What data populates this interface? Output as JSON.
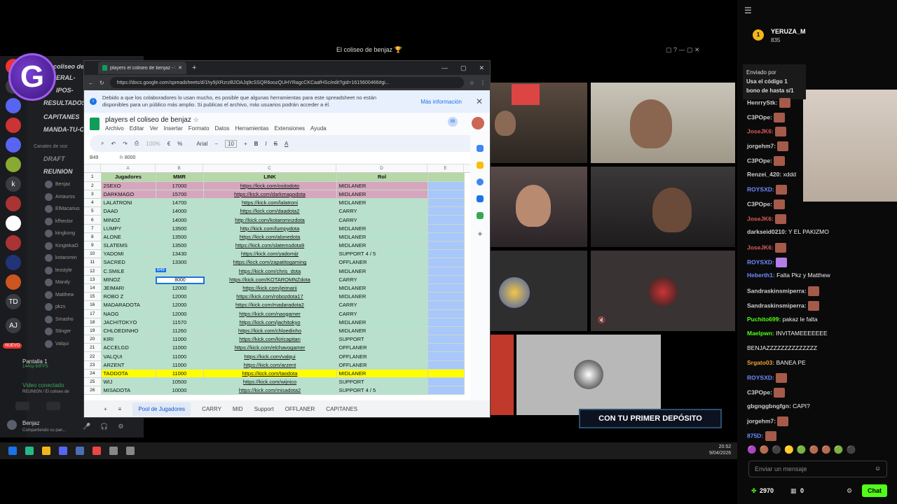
{
  "stream": {
    "title": "El coliseo de benjaz 🏆"
  },
  "discord": {
    "server_partial": "coliseo de",
    "channels": [
      "ERAL-",
      "IPOS-",
      "RESULTADOS",
      "CAPITANES",
      "MANDA-TU-C",
      "DRAFT"
    ],
    "voice_section": "Canales de voz",
    "voice_channel": "REUNION",
    "voice_users": [
      "Benjaz",
      "Antauros",
      "ElMacarius",
      "kfhector",
      "kingkong",
      "KingtekaO",
      "kotaromin",
      "leostyle",
      "Mandy",
      "Matthew",
      "pkzs",
      "Smasho",
      "Stinger",
      "Valqui"
    ],
    "screen_label": "Pantalla 1",
    "screen_sub": "1440p 60FPS",
    "video_status": "Video conectado",
    "video_channel": "REUNION / El coliseo de",
    "user_name": "Benjaz",
    "user_status": "Compartiendo su pan...",
    "nuevo": "NUEVO"
  },
  "chrome": {
    "tab_title": "players el coliseo de benjaz - Hoja",
    "url": "https://docs.google.com/spreadsheets/d/1hy9jXRzrzB2OAJq9cSSQR6oozQUHYRagcCKCaafHSc/edit?gid=1615600466#gi...",
    "notice": "Debido a que los colaboradores lo usan mucho, es posible que algunas herramientas para este spreadsheet no están disponibles para un público más amplio. Si publicas el archivo, más usuarios podrán acceder a él.",
    "notice_more": "Más información",
    "doc_title": "players el coliseo de benjaz",
    "menus": [
      "Archivo",
      "Editar",
      "Ver",
      "Insertar",
      "Formato",
      "Datos",
      "Herramientas",
      "Extensiones",
      "Ayuda"
    ],
    "font": "Arial",
    "font_size": "10",
    "zoom": "100%",
    "cell_ref": "B49",
    "formula_value": "8000",
    "cols": [
      "A",
      "B",
      "C",
      "D",
      "E"
    ],
    "headers": [
      "Jugadores",
      "MMR",
      "LINK",
      "Rol"
    ],
    "rows": [
      {
        "n": "2",
        "name": "2SEXO",
        "mmr": "17000",
        "link": "https://kick.com/ositodoto",
        "rol": "MIDLANER",
        "c": "p"
      },
      {
        "n": "3",
        "name": "DARKMAGO",
        "mmr": "15700",
        "link": "https://kick.com/darkmagodota",
        "rol": "MIDLANER",
        "c": "p"
      },
      {
        "n": "4",
        "name": "LALATRONI",
        "mmr": "14700",
        "link": "https://kick.com/lalatroni",
        "rol": "MIDLANER",
        "c": "g"
      },
      {
        "n": "5",
        "name": "DAAD",
        "mmr": "14000",
        "link": "https://kick.com/daadota2",
        "rol": "CARRY",
        "c": "g"
      },
      {
        "n": "6",
        "name": "MINOZ",
        "mmr": "14000",
        "link": "http://kick.com/kotaromnzdota",
        "rol": "CARRY",
        "c": "g"
      },
      {
        "n": "7",
        "name": "LUMPY",
        "mmr": "13500",
        "link": "http://kick.com/lumpydota",
        "rol": "MIDLANER",
        "c": "g"
      },
      {
        "n": "8",
        "name": "ALONE",
        "mmr": "13500",
        "link": "https://kick.com/alonedota",
        "rol": "MIDLANER",
        "c": "g"
      },
      {
        "n": "9",
        "name": "SLATEMS",
        "mmr": "13500",
        "link": "https://kick.com/slatemsdota9",
        "rol": "MIDLANER",
        "c": "g"
      },
      {
        "n": "10",
        "name": "YADOMI",
        "mmr": "13430",
        "link": "https://kick.com/yadomijr",
        "rol": "SUPPORT 4 / 5",
        "c": "g"
      },
      {
        "n": "11",
        "name": "SACRED",
        "mmr": "13300",
        "link": "https://kick.com/zapatitogaming",
        "rol": "OFFLANER",
        "c": "g"
      },
      {
        "n": "12",
        "name": "C.SMILE",
        "mmr": "",
        "link": "https://kick.com/chris_dota",
        "rol": "MIDLANER",
        "c": "g"
      },
      {
        "n": "13",
        "name": "MINOZ",
        "mmr": "",
        "link": "https://kick.com/KOTAROMNZdota",
        "rol": "CARRY",
        "c": "g"
      },
      {
        "n": "14",
        "name": "JEIMARI",
        "mmr": "12000",
        "link": "https://kick.com/jeimarii",
        "rol": "MIDLANER",
        "c": "g"
      },
      {
        "n": "15",
        "name": "ROBO Z",
        "mmr": "12000",
        "link": "https://kick.com/robozdota17",
        "rol": "MIDLANER",
        "c": "g"
      },
      {
        "n": "16",
        "name": "MADARADOTA",
        "mmr": "12000",
        "link": "https://kick.com/madaradota2",
        "rol": "CARRY",
        "c": "g"
      },
      {
        "n": "17",
        "name": "NAOG",
        "mmr": "12000",
        "link": "https://kick.com/naogamer",
        "rol": "CARRY",
        "c": "g"
      },
      {
        "n": "18",
        "name": "JACHITOKYO",
        "mmr": "11570",
        "link": "https://kick.com/jachitokyo",
        "rol": "MIDLANER",
        "c": "g"
      },
      {
        "n": "19",
        "name": "CHLOEDINHO",
        "mmr": "11260",
        "link": "https://kick.com/chloedinho",
        "rol": "MIDLANER",
        "c": "g"
      },
      {
        "n": "20",
        "name": "KIRI",
        "mmr": "11000",
        "link": "https://kick.com/kiricapitan",
        "rol": "SUPPORT",
        "c": "g"
      },
      {
        "n": "21",
        "name": "ACCELGD",
        "mmr": "11000",
        "link": "https://kick.com/elchavogamer",
        "rol": "OFFLANER",
        "c": "g"
      },
      {
        "n": "22",
        "name": "VALQUI",
        "mmr": "11000",
        "link": "https://kick.com/valqui",
        "rol": "OFFLANER",
        "c": "g"
      },
      {
        "n": "23",
        "name": "ARZENT",
        "mmr": "11000",
        "link": "https://kick.com/arzent",
        "rol": "OFFLANER",
        "c": "g"
      },
      {
        "n": "24",
        "name": "TAODOTA",
        "mmr": "11000",
        "link": "https://kick.com/taodota",
        "rol": "MIDLANER",
        "c": "y"
      },
      {
        "n": "25",
        "name": "WIJ",
        "mmr": "10500",
        "link": "https://kick.com/wijnico",
        "rol": "SUPPORT",
        "c": "g"
      },
      {
        "n": "26",
        "name": "MISADOTA",
        "mmr": "10000",
        "link": "https://kick.com/misadota2",
        "rol": "SUPPORT 4 / 5",
        "c": "g"
      }
    ],
    "edit_cell_value": "8000",
    "edit_cell_tag": "B49",
    "sheet_tabs": [
      "Pool de Jugadores",
      "CARRY",
      "MID",
      "Support",
      "OFFLANER",
      "CAPITANES"
    ]
  },
  "promo": "CON TU PRIMER DEPÓSITO",
  "taskbar": {
    "time": "20:52",
    "date": "9/04/2026"
  },
  "chat": {
    "top_user": "YERUZA_M",
    "top_points": "835",
    "pinned_label": "Enviado por",
    "pinned_text1": "Usa el código 1",
    "pinned_text2": "bono de hasta s/1",
    "messages": [
      {
        "n": "HenrryStk:",
        "c": "#cfcfcf",
        "t": "",
        "e": 1
      },
      {
        "n": "C3POpe:",
        "c": "#cfcfcf",
        "t": "",
        "e": 1
      },
      {
        "n": "JoseJK6:",
        "c": "#e05a5a",
        "t": "",
        "e": 1
      },
      {
        "n": "jorgehm7:",
        "c": "#cfcfcf",
        "t": "",
        "e": 1
      },
      {
        "n": "C3POpe:",
        "c": "#cfcfcf",
        "t": "",
        "e": 1
      },
      {
        "n": "Renzei_420:",
        "c": "#cfcfcf",
        "t": "xddd",
        "e": 0
      },
      {
        "n": "ROYSXD:",
        "c": "#6f8cff",
        "t": "",
        "e": 1
      },
      {
        "n": "C3POpe:",
        "c": "#cfcfcf",
        "t": "",
        "e": 1
      },
      {
        "n": "JoseJK6:",
        "c": "#e05a5a",
        "t": "",
        "e": 1
      },
      {
        "n": "darkseid0210:",
        "c": "#cfcfcf",
        "t": "Y EL PAKIZMO",
        "e": 0
      },
      {
        "n": "JoseJK6:",
        "c": "#e05a5a",
        "t": "",
        "e": 1
      },
      {
        "n": "ROYSXD:",
        "c": "#6f8cff",
        "t": "",
        "e": 2
      },
      {
        "n": "Heberth1:",
        "c": "#6f8cff",
        "t": "Falta Pkz y Matthew",
        "e": 0
      },
      {
        "n": "Sandraskinsmiperra:",
        "c": "#cfcfcf",
        "t": "",
        "e": 1
      },
      {
        "n": "Sandraskinsmiperra:",
        "c": "#cfcfcf",
        "t": "",
        "e": 1
      },
      {
        "n": "Puchito699:",
        "c": "#53fc18",
        "t": "pakaz le falta",
        "e": 0
      },
      {
        "n": "Maelpwn:",
        "c": "#53fc18",
        "t": "INVITAMEEEEEEE",
        "e": 0
      },
      {
        "n": "",
        "c": "#cfcfcf",
        "t": "BENJAZZZZZZZZZZZZZZ",
        "e": 0
      },
      {
        "n": "Srgato03:",
        "c": "#f0a030",
        "t": "BANEA PE",
        "e": 0
      },
      {
        "n": "ROYSXD:",
        "c": "#6f8cff",
        "t": "",
        "e": 1
      },
      {
        "n": "C3POpe:",
        "c": "#cfcfcf",
        "t": "",
        "e": 1
      },
      {
        "n": "gbgnggbngfgn:",
        "c": "#cfcfcf",
        "t": "CAPI?",
        "e": 0
      },
      {
        "n": "jorgehm7:",
        "c": "#cfcfcf",
        "t": "",
        "e": 1
      },
      {
        "n": "875D:",
        "c": "#6f8cff",
        "t": "",
        "e": 1
      }
    ],
    "input_placeholder": "Enviar un mensaje",
    "points": "2970",
    "bank": "0",
    "chat_button": "Chat"
  }
}
